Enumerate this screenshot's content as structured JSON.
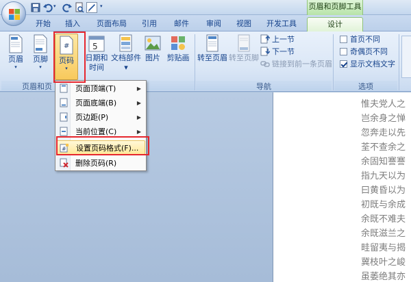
{
  "titlebar": {
    "context_title": "页眉和页脚工具"
  },
  "tabs": [
    "开始",
    "插入",
    "页面布局",
    "引用",
    "邮件",
    "审阅",
    "视图",
    "开发工具",
    "设计"
  ],
  "ribbon": {
    "buttons": {
      "header": "页眉",
      "footer": "页脚",
      "page_number": "页码",
      "date_time": [
        "日期和",
        "时间"
      ],
      "doc_parts": [
        "文档部件",
        "▾"
      ],
      "picture": "图片",
      "clipart": "剪贴画",
      "goto_header": "转至页眉",
      "goto_footer": "转至页脚"
    },
    "nav_small": [
      "上一节",
      "下一节",
      "链接到前一条页眉"
    ],
    "options": [
      {
        "label": "首页不同",
        "checked": false
      },
      {
        "label": "奇偶页不同",
        "checked": false
      },
      {
        "label": "显示文档文字",
        "checked": true
      }
    ],
    "groups": {
      "header_footer": "页眉和页",
      "nav": "导航",
      "options": "选项"
    }
  },
  "menu": [
    {
      "label": "页面顶端(T)",
      "submenu": true
    },
    {
      "label": "页面底端(B)",
      "submenu": true
    },
    {
      "label": "页边距(P)",
      "submenu": true
    },
    {
      "label": "当前位置(C)",
      "submenu": true
    },
    {
      "label": "设置页码格式(F)...",
      "submenu": false,
      "highlighted": true
    },
    {
      "label": "删除页码(R)",
      "submenu": false
    }
  ],
  "document_lines": [
    "惟夫党人之",
    "岂余身之惮",
    "忽奔走以先",
    "荃不查余之",
    "余固知謇謇",
    "指九天以为",
    "曰黄昏以为",
    "初既与余成",
    "余既不难夫",
    "余既滋兰之",
    "畦留夷与揭",
    "冀枝叶之峻",
    "虽萎绝其亦"
  ],
  "colors": {
    "ribbon_text": "#15428b",
    "highlight_box": "#e6262e",
    "context_tab": "#b7e3a8"
  }
}
